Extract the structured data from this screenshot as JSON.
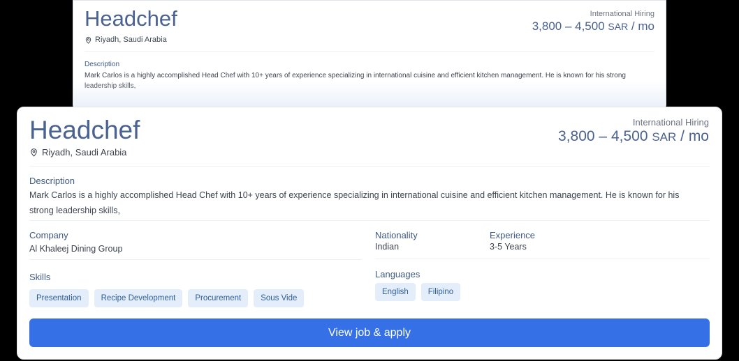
{
  "job": {
    "title": "Headchef",
    "location": "Riyadh, Saudi Arabia",
    "hiring_type": "International Hiring",
    "salary_range": "3,800 – 4,500",
    "salary_currency": "SAR",
    "salary_period": " / mo",
    "description_label": "Description",
    "description": "Mark Carlos is a highly accomplished Head Chef with 10+ years of experience specializing in international cuisine and efficient kitchen management. He is known for his strong leadership skills,",
    "company_label": "Company",
    "company": "Al Khaleej Dining Group",
    "nationality_label": "Nationality",
    "nationality": "Indian",
    "experience_label": "Experience",
    "experience": "3-5 Years",
    "skills_label": "Skills",
    "skills": [
      "Presentation",
      "Recipe Development",
      "Procurement",
      "Sous Vide"
    ],
    "languages_label": "Languages",
    "languages": [
      "English",
      "Filipino"
    ],
    "apply_label": "View job & apply"
  },
  "icons": {
    "location": "map-pin-icon"
  },
  "colors": {
    "accent": "#3570e6",
    "title": "#4a6291",
    "chip_bg": "#e4eefb",
    "chip_text": "#2f5d9a"
  }
}
